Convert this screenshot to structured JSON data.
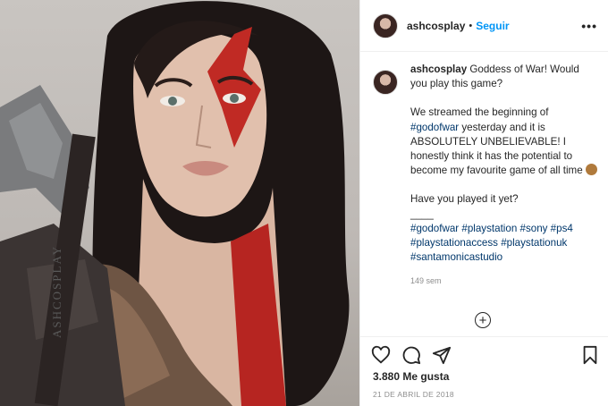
{
  "post": {
    "username": "ashcosplay",
    "follow_label": "Seguir",
    "separator": "•",
    "more_label": "•••",
    "caption_user": "ashcosplay",
    "caption_line1": " Goddess of War! Would you play this game?",
    "p2_a": "We streamed the beginning of ",
    "p2_tag": "#godofwar",
    "p2_b": " yesterday and it is ABSOLUTELY UNBELIEVABLE! I honestly think it has the potential to become my favourite game of all time ",
    "p3": "Have you played it yet?",
    "rule": "____",
    "hashtags": [
      "#godofwar",
      "#playstation",
      "#sony",
      "#ps4",
      "#playstationaccess",
      "#playstationuk",
      "#santamonicastudio"
    ],
    "time_ago": "149 sem",
    "load_more": "+",
    "likes": "3.880 Me gusta",
    "date": "21 DE ABRIL DE 2018",
    "photo_watermark": "ASHCOSPLAY"
  },
  "icons": [
    "heart-icon",
    "comment-icon",
    "share-icon",
    "bookmark-icon",
    "monkey-emoji-icon",
    "plus-circle-icon",
    "more-icon"
  ],
  "colors": {
    "link": "#0095f6",
    "hashtag": "#00376b",
    "meta": "#8e8e8e",
    "text": "#262626"
  }
}
